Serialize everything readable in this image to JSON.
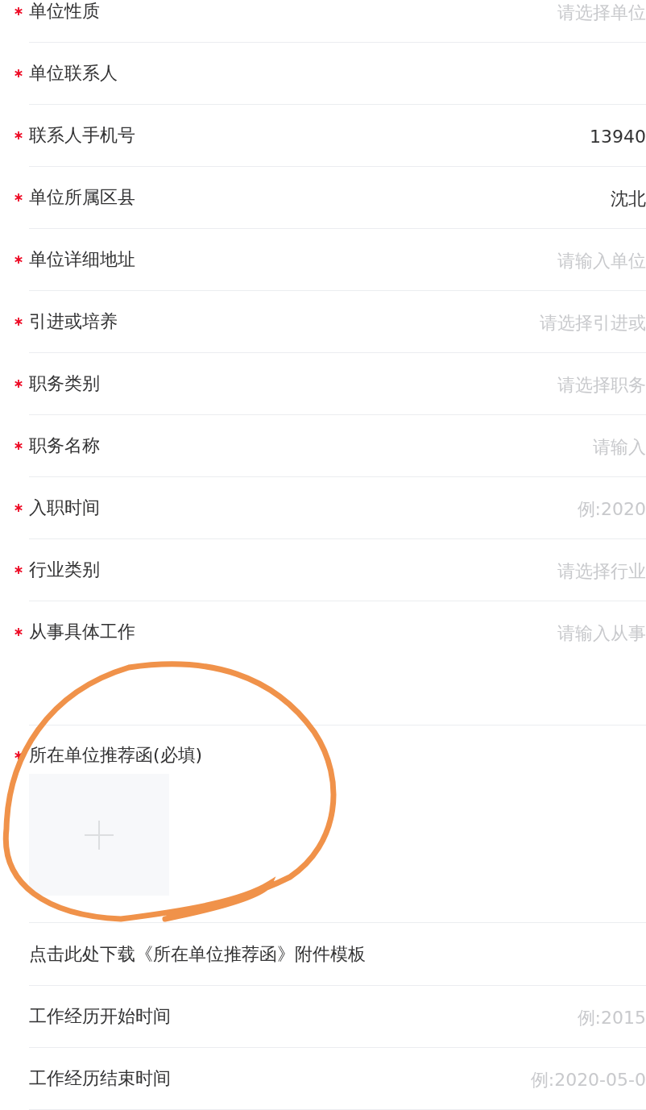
{
  "fields": [
    {
      "label": "单位性质",
      "required": true,
      "placeholder": "请选择单位"
    },
    {
      "label": "单位联系人",
      "required": true
    },
    {
      "label": "联系人手机号",
      "required": true,
      "value": "13940"
    },
    {
      "label": "单位所属区县",
      "required": true,
      "value": "沈北"
    },
    {
      "label": "单位详细地址",
      "required": true,
      "placeholder": "请输入单位"
    },
    {
      "label": "引进或培养",
      "required": true,
      "placeholder": "请选择引进或"
    },
    {
      "label": "职务类别",
      "required": true,
      "placeholder": "请选择职务"
    },
    {
      "label": "职务名称",
      "required": true,
      "placeholder": "请输入"
    },
    {
      "label": "入职时间",
      "required": true,
      "placeholder": "例:2020"
    },
    {
      "label": "行业类别",
      "required": true,
      "placeholder": "请选择行业"
    },
    {
      "label": "从事具体工作",
      "required": true,
      "placeholder": "请输入从事",
      "kind": "textarea"
    }
  ],
  "upload": {
    "label": "所在单位推荐函(必填)",
    "required": true
  },
  "template_link": "点击此处下载《所在单位推荐函》附件模板",
  "work_fields": [
    {
      "label": "工作经历开始时间",
      "required": false,
      "placeholder": "例:2015"
    },
    {
      "label": "工作经历结束时间",
      "required": false,
      "placeholder": "例:2020-05-0"
    }
  ]
}
